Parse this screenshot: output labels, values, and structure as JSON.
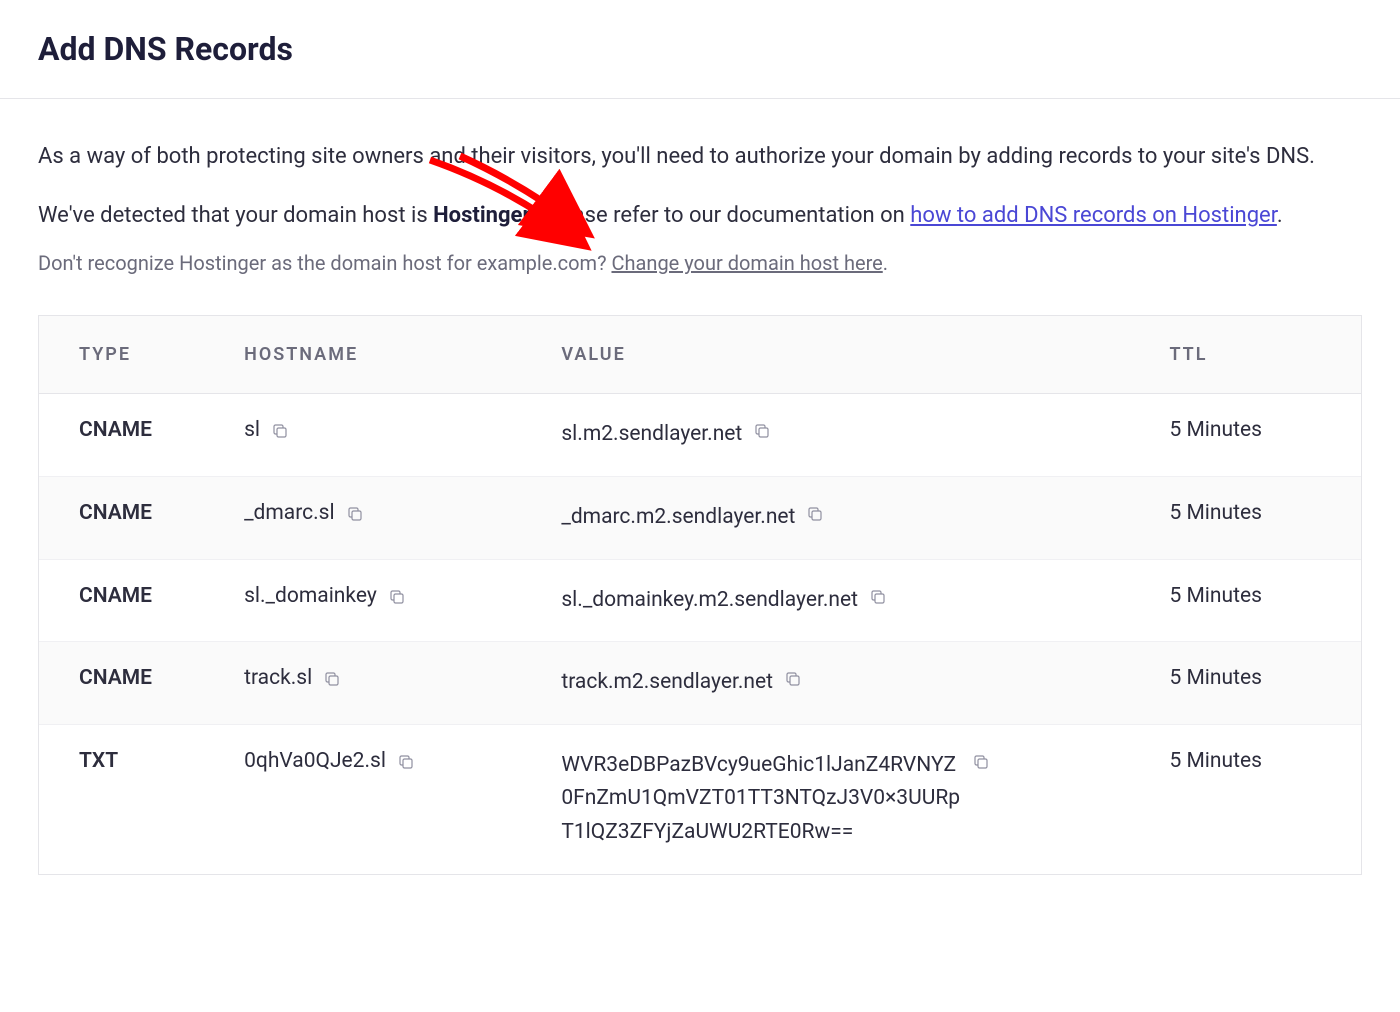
{
  "header": {
    "title": "Add DNS Records"
  },
  "intro": {
    "text": "As a way of both protecting site owners and their visitors, you'll need to authorize your domain by adding records to your site's DNS."
  },
  "detect": {
    "prefix": "We've detected that your domain host is ",
    "host": "Hostinger",
    "middle": ". Please refer to our documentation on ",
    "link": "how to add DNS records on Hostinger",
    "suffix": "."
  },
  "dont_recognize": {
    "prefix": "Don't recognize Hostinger as the domain host for example.com? ",
    "link": "Change your domain host here",
    "suffix": "."
  },
  "table": {
    "headers": {
      "type": "TYPE",
      "hostname": "HOSTNAME",
      "value": "VALUE",
      "ttl": "TTL"
    },
    "rows": [
      {
        "type": "CNAME",
        "hostname": "sl",
        "value": "sl.m2.sendlayer.net",
        "ttl": "5 Minutes"
      },
      {
        "type": "CNAME",
        "hostname": "_dmarc.sl",
        "value": "_dmarc.m2.sendlayer.net",
        "ttl": "5 Minutes"
      },
      {
        "type": "CNAME",
        "hostname": "sl._domainkey",
        "value": "sl._domainkey.m2.sendlayer.net",
        "ttl": "5 Minutes"
      },
      {
        "type": "CNAME",
        "hostname": "track.sl",
        "value": "track.m2.sendlayer.net",
        "ttl": "5 Minutes"
      },
      {
        "type": "TXT",
        "hostname": "0qhVa0QJe2.sl",
        "value": "WVR3eDBPazBVcy9ueGhic1lJanZ4RVNYZ0FnZmU1QmVZT01TT3NTQzJ3V0×3UURpT1lQZ3ZFYjZaUWU2RTE0Rw==",
        "ttl": "5 Minutes"
      }
    ]
  }
}
